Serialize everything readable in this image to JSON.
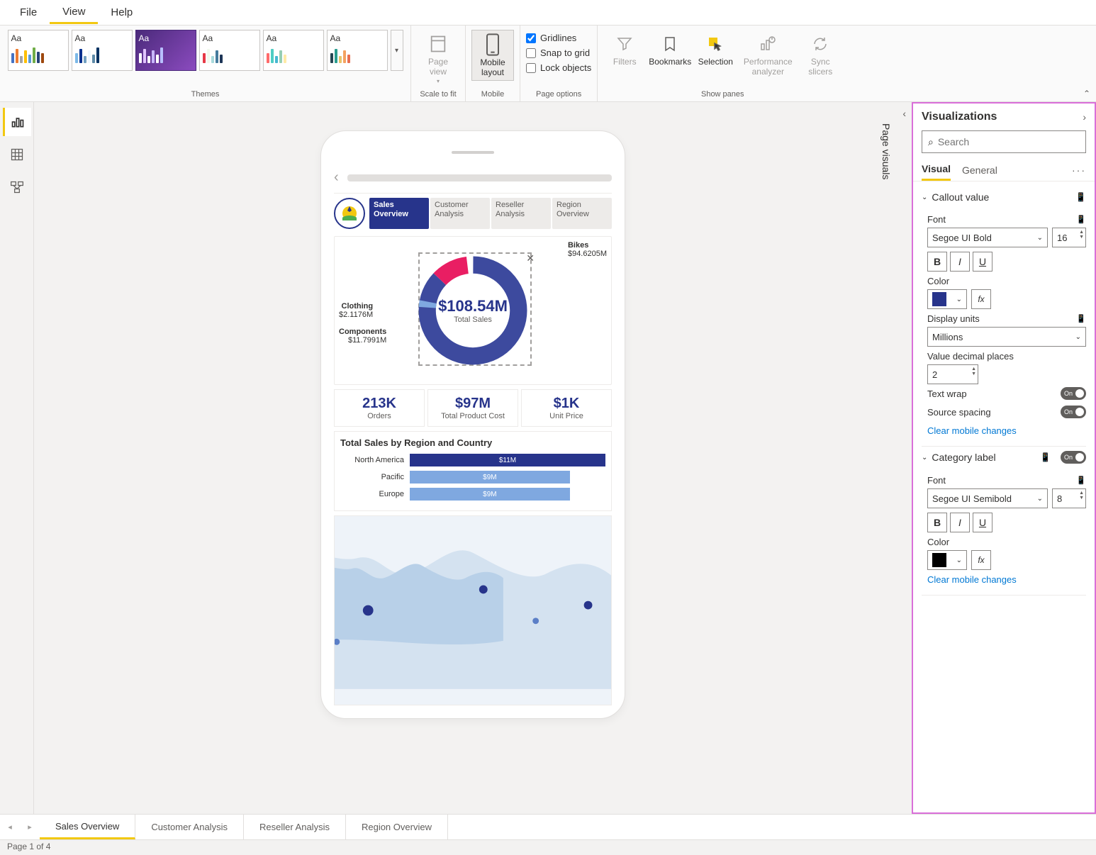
{
  "menubar": {
    "file": "File",
    "view": "View",
    "help": "Help"
  },
  "ribbon": {
    "themes_label": "Themes",
    "theme_aa": "Aa",
    "scale_to_fit_label": "Scale to fit",
    "page_view": "Page view",
    "mobile_label": "Mobile",
    "mobile_layout": "Mobile layout",
    "page_options_label": "Page options",
    "gridlines": "Gridlines",
    "snap_to_grid": "Snap to grid",
    "lock_objects": "Lock objects",
    "show_panes_label": "Show panes",
    "filters": "Filters",
    "bookmarks": "Bookmarks",
    "selection": "Selection",
    "perf_analyzer": "Performance analyzer",
    "sync_slicers": "Sync slicers"
  },
  "vertical_pane_label": "Page visuals",
  "device": {
    "tabs": [
      {
        "l1": "Sales",
        "l2": "Overview",
        "active": true
      },
      {
        "l1": "Customer",
        "l2": "Analysis",
        "active": false
      },
      {
        "l1": "Reseller",
        "l2": "Analysis",
        "active": false
      },
      {
        "l1": "Region",
        "l2": "Overview",
        "active": false
      }
    ],
    "donut": {
      "center_value": "$108.54M",
      "center_label": "Total Sales",
      "legends": [
        {
          "name": "Bikes",
          "value": "$94.6205M",
          "pos": "top-right"
        },
        {
          "name": "Clothing",
          "value": "$2.1176M",
          "pos": "mid-left"
        },
        {
          "name": "Components",
          "value": "$11.7991M",
          "pos": "bot-left"
        }
      ]
    },
    "kpis": [
      {
        "value": "213K",
        "label": "Orders"
      },
      {
        "value": "$97M",
        "label": "Total Product Cost"
      },
      {
        "value": "$1K",
        "label": "Unit Price"
      }
    ],
    "bar_title": "Total Sales by Region and Country"
  },
  "chart_data": {
    "type": "bar",
    "title": "Total Sales by Region and Country",
    "categories": [
      "North America",
      "Pacific",
      "Europe"
    ],
    "values": [
      11,
      9,
      9
    ],
    "value_labels": [
      "$11M",
      "$9M",
      "$9M"
    ],
    "colors": [
      "#27348b",
      "#7fa8e0",
      "#7fa8e0"
    ],
    "xlabel": "",
    "ylabel": "",
    "orientation": "horizontal"
  },
  "rightpane": {
    "title": "Visualizations",
    "search_placeholder": "Search",
    "tab_visual": "Visual",
    "tab_general": "General",
    "sec_callout": "Callout value",
    "font_label": "Font",
    "font_family_1": "Segoe UI Bold",
    "font_size_1": "16",
    "color_label": "Color",
    "color_1": "#27348b",
    "display_units_label": "Display units",
    "display_units_value": "Millions",
    "decimal_label": "Value decimal places",
    "decimal_value": "2",
    "text_wrap": "Text wrap",
    "source_spacing": "Source spacing",
    "toggle_on": "On",
    "clear_mobile": "Clear mobile changes",
    "sec_category": "Category label",
    "font_family_2": "Segoe UI Semibold",
    "font_size_2": "8",
    "color_2": "#000000"
  },
  "page_tabs": {
    "tabs": [
      "Sales Overview",
      "Customer Analysis",
      "Reseller Analysis",
      "Region Overview"
    ]
  },
  "statusbar": {
    "text": "Page 1 of 4"
  }
}
